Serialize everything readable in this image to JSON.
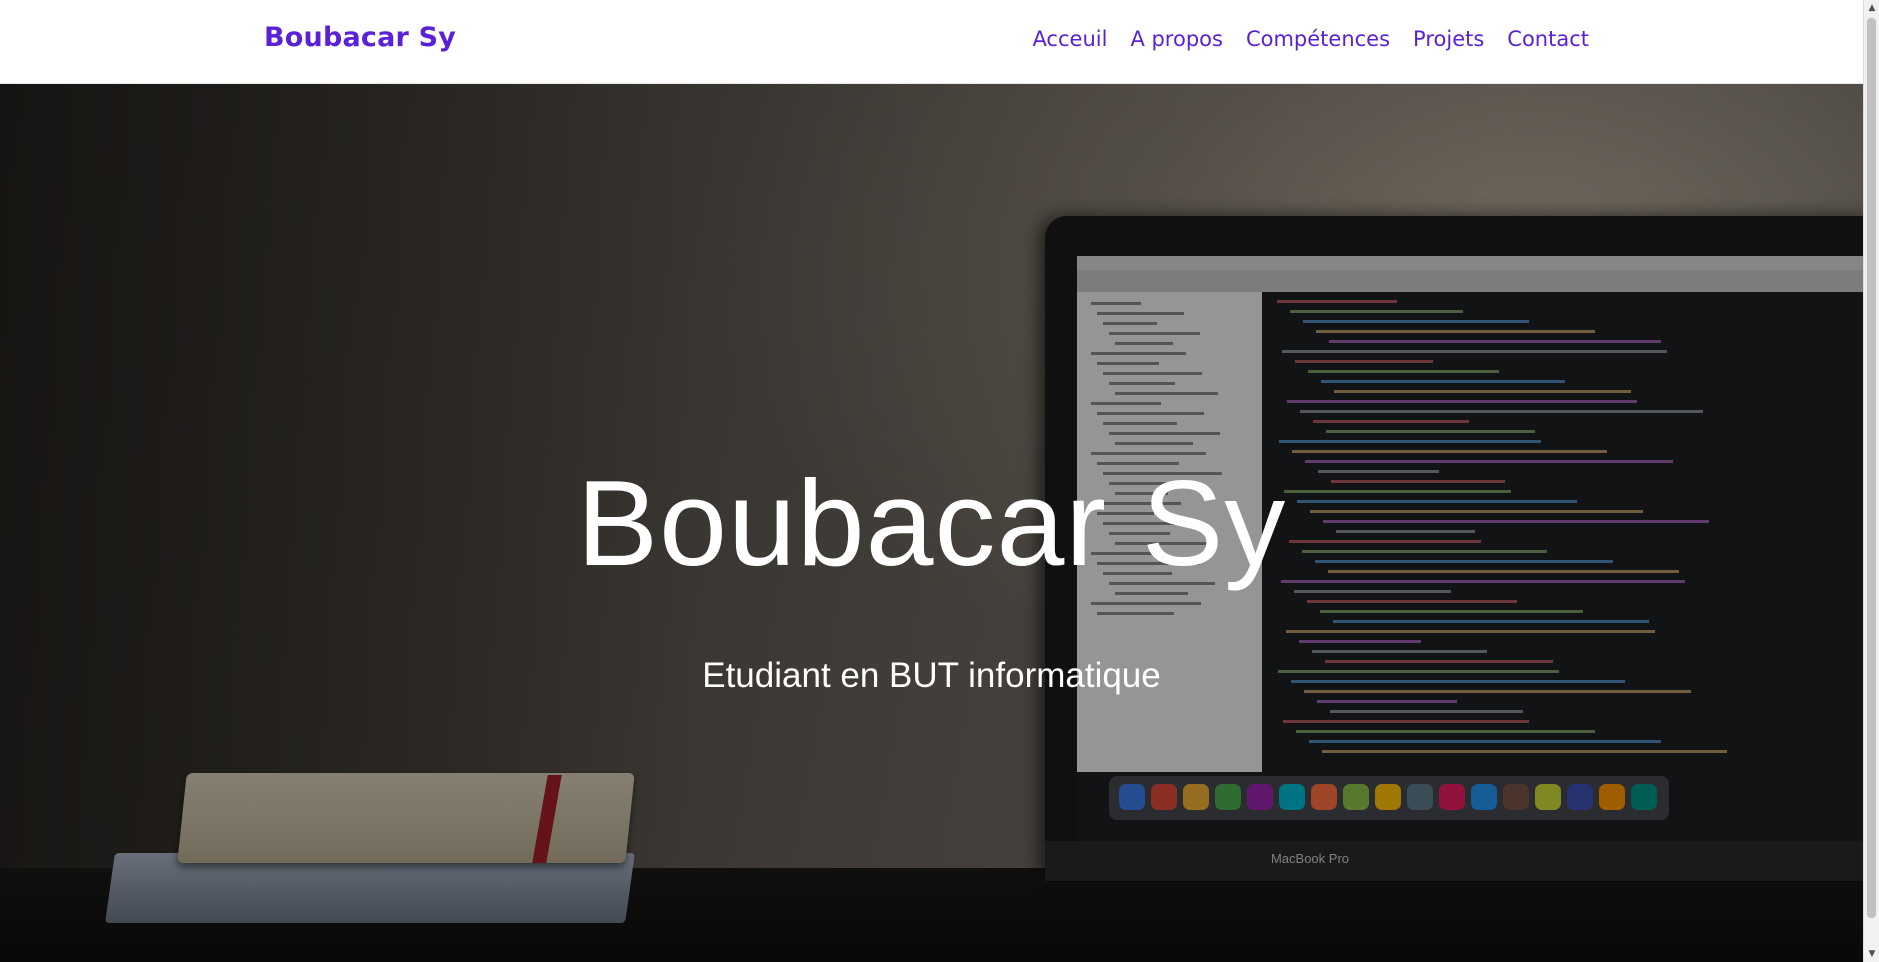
{
  "header": {
    "brand": "Boubacar Sy",
    "nav": [
      {
        "label": "Acceuil"
      },
      {
        "label": "A propos"
      },
      {
        "label": "Compétences"
      },
      {
        "label": "Projets"
      },
      {
        "label": "Contact"
      }
    ]
  },
  "hero": {
    "title": "Boubacar Sy",
    "subtitle": "Etudiant en BUT informatique",
    "background_image": {
      "laptop_label": "MacBook Pro"
    }
  },
  "colors": {
    "accent": "#5b21d6",
    "hero_text": "#ffffff"
  },
  "scrollbar": {
    "up_icon": "triangle-up-icon",
    "down_icon": "triangle-down-icon"
  }
}
